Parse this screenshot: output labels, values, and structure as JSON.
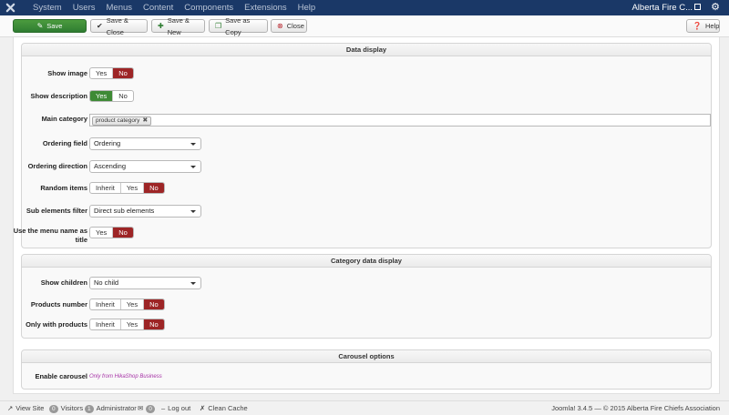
{
  "topbar": {
    "menu": [
      "System",
      "Users",
      "Menus",
      "Content",
      "Components",
      "Extensions",
      "Help"
    ],
    "site_name": "Alberta Fire C...",
    "logo_icon": "joomla-logo-icon",
    "settings_icon": "gear-icon"
  },
  "toolbar": {
    "save": "Save",
    "save_close": "Save & Close",
    "save_new": "Save & New",
    "save_copy": "Save as Copy",
    "close": "Close",
    "help": "Help"
  },
  "data_display": {
    "legend": "Data display",
    "show_image": {
      "label": "Show image",
      "options": [
        "Yes",
        "No"
      ],
      "selected": "No"
    },
    "show_description": {
      "label": "Show description",
      "options": [
        "Yes",
        "No"
      ],
      "selected": "Yes"
    },
    "main_category": {
      "label": "Main category",
      "tag": "product category"
    },
    "ordering_field": {
      "label": "Ordering field",
      "value": "Ordering"
    },
    "ordering_direction": {
      "label": "Ordering direction",
      "value": "Ascending"
    },
    "random_items": {
      "label": "Random items",
      "options": [
        "Inherit",
        "Yes",
        "No"
      ],
      "selected": "No"
    },
    "sub_elements_filter": {
      "label": "Sub elements filter",
      "value": "Direct sub elements"
    },
    "menu_name_title": {
      "label": "Use the menu name as title",
      "options": [
        "Yes",
        "No"
      ],
      "selected": "No"
    }
  },
  "category_display": {
    "legend": "Category data display",
    "show_children": {
      "label": "Show children",
      "value": "No child"
    },
    "products_number": {
      "label": "Products number",
      "options": [
        "Inherit",
        "Yes",
        "No"
      ],
      "selected": "No"
    },
    "only_with_products": {
      "label": "Only with products",
      "options": [
        "Inherit",
        "Yes",
        "No"
      ],
      "selected": "No"
    }
  },
  "carousel": {
    "legend": "Carousel options",
    "enable_carousel": {
      "label": "Enable carousel",
      "note": "Only from HikaShop Business"
    }
  },
  "statusbar": {
    "view_site": "View Site",
    "visitors_count": "0",
    "visitors": "Visitors",
    "admin_count": "1",
    "administrator": "Administrator",
    "messages_count": "0",
    "logout": "Log out",
    "clean_cache": "Clean Cache",
    "version_info": "Joomla! 3.4.5 — © 2015 Alberta Fire Chiefs Association"
  },
  "colors": {
    "navbar": "#1a3867",
    "save_green": "#3e8a35",
    "toggle_no_red": "#9d2526"
  }
}
